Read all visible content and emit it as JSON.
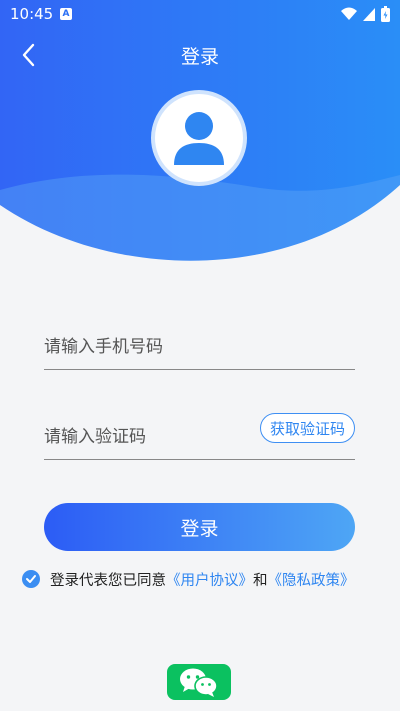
{
  "status_bar": {
    "time": "10:45",
    "notification_letter": "A",
    "icons": [
      "wifi-icon",
      "signal-icon",
      "battery-icon"
    ]
  },
  "header": {
    "title": "登录",
    "back_icon": "chevron-left-icon"
  },
  "avatar": {
    "icon": "user-icon"
  },
  "phone_field": {
    "placeholder": "请输入手机号码",
    "value": ""
  },
  "code_field": {
    "placeholder": "请输入验证码",
    "value": "",
    "send_button": "获取验证码"
  },
  "login_button": "登录",
  "agreement": {
    "checked": true,
    "text": "登录代表您已同意",
    "user_agreement": "《用户协议》",
    "and": "和",
    "privacy_policy": "《隐私政策》"
  },
  "third_party": {
    "icon": "wechat-icon"
  },
  "colors": {
    "header_start": "#3265f5",
    "header_end": "#2a8ef7",
    "accent": "#2f86f1",
    "wechat": "#0bc160"
  }
}
